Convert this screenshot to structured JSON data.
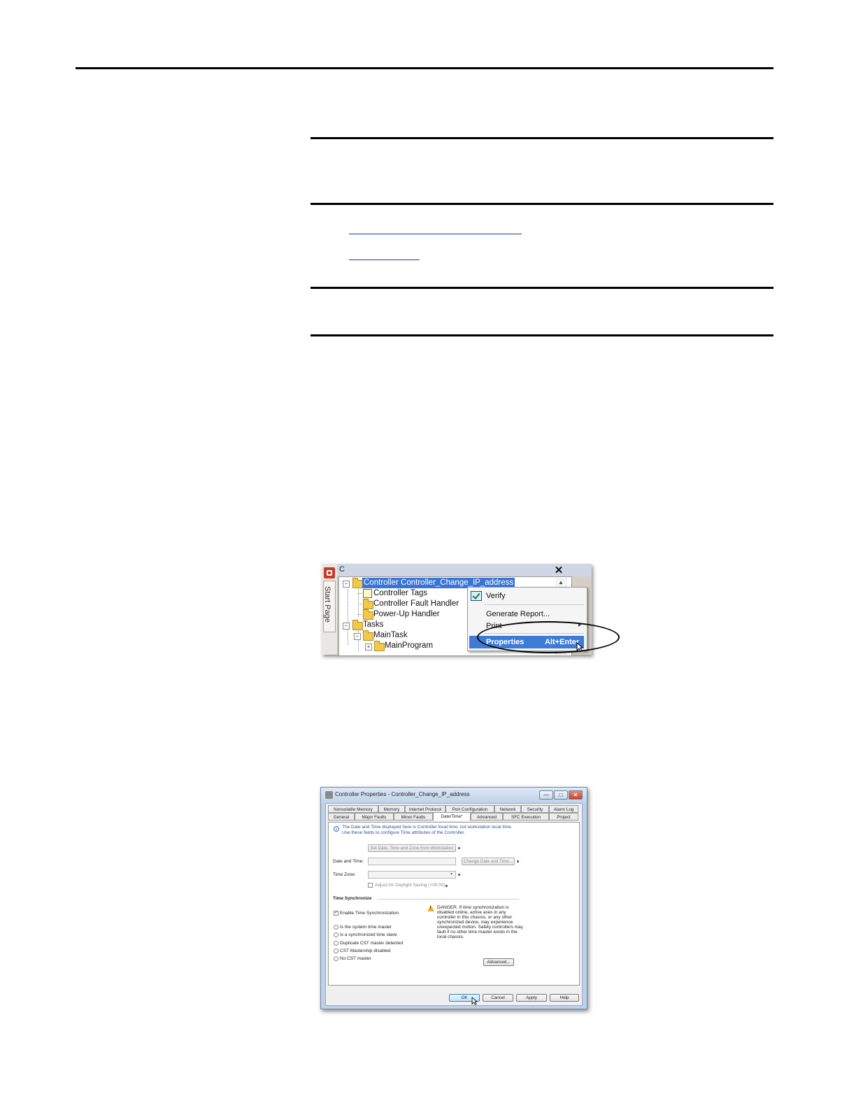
{
  "screenshot_tree": {
    "panel_title_fragment": "C",
    "start_page_label": "Start Page",
    "close_glyph": "✕",
    "tree": {
      "controller": "Controller Controller_Change_IP_address",
      "controller_tags": "Controller Tags",
      "fault_handler": "Controller Fault Handler",
      "powerup_handler": "Power-Up Handler",
      "tasks": "Tasks",
      "main_task": "MainTask",
      "main_program": "MainProgram"
    },
    "context_menu": {
      "verify": "Verify",
      "generate_report": "Generate Report...",
      "print": "Print",
      "properties": "Properties",
      "properties_shortcut": "Alt+Enter"
    }
  },
  "screenshot_dialog": {
    "title": "Controller Properties - Controller_Change_IP_address",
    "window_buttons": {
      "minimize": "—",
      "maximize": "□",
      "close": "✕"
    },
    "tabs_row1": [
      "Nonvolatile Memory",
      "Memory",
      "Internet Protocol",
      "Port Configuration",
      "Network",
      "Security",
      "Alarm Log"
    ],
    "tabs_row2": [
      "General",
      "Major Faults",
      "Minor Faults",
      "Date/Time*",
      "Advanced",
      "SFC Execution",
      "Project"
    ],
    "info_line1": "The Date and Time displayed here is Controller local time, not workstation local time.",
    "info_line2": "Use these fields to configure Time attributes of the Controller.",
    "set_from_workstation_button": "Set Date, Time and Zone from Workstation",
    "date_time_label": "Date and Time:",
    "change_date_time_button": "Change Date and Time...",
    "time_zone_label": "Time Zone:",
    "daylight_saving_label": "Adjust for Daylight Saving (+00:00)",
    "time_sync_heading": "Time Synchronize",
    "enable_time_sync_label": "Enable Time Synchronization",
    "radio_options": [
      "Is the system time master",
      "Is a synchronized time slave",
      "Duplicate CST master detected",
      "CST Mastership disabled",
      "No CST master"
    ],
    "danger_lines": [
      "DANGER. If time synchronization is",
      "disabled online, active axes in any",
      "controller in this chassis, or any other",
      "synchronized device, may experience",
      "unexpected motion.  Safety controllers may",
      "fault if no other time master exists in the",
      "local chassis."
    ],
    "advanced_button": "Advanced...",
    "footer_buttons": {
      "ok": "OK",
      "cancel": "Cancel",
      "apply": "Apply",
      "help": "Help"
    }
  }
}
